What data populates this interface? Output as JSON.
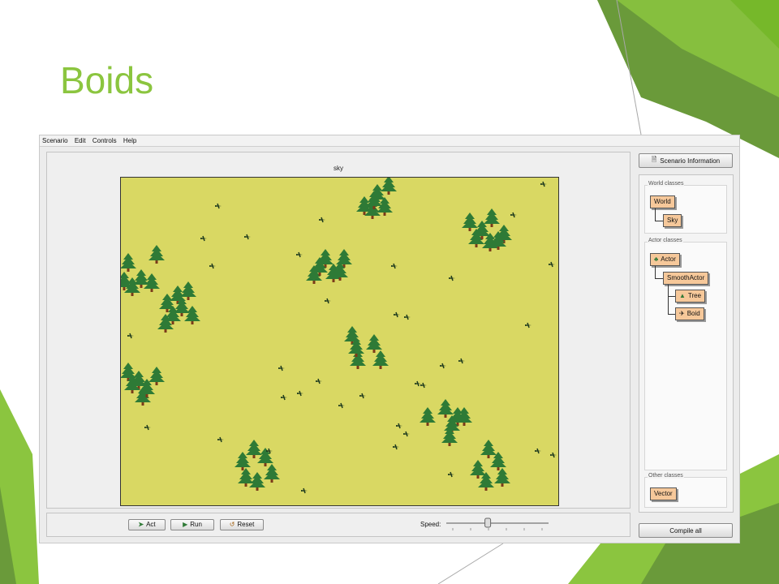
{
  "slide": {
    "title": "Boids"
  },
  "menu": {
    "items": [
      "Scenario",
      "Edit",
      "Controls",
      "Help"
    ]
  },
  "world": {
    "name": "sky"
  },
  "controls": {
    "act_label": "Act",
    "run_label": "Run",
    "reset_label": "Reset",
    "speed_label": "Speed:",
    "speed_value": 0.4
  },
  "sidebar": {
    "scenario_info_label": "Scenario Information",
    "world_classes_title": "World classes",
    "actor_classes_title": "Actor classes",
    "other_classes_title": "Other classes",
    "world_classes": [
      "World",
      "Sky"
    ],
    "actor_classes": [
      "Actor",
      "SmoothActor",
      "Tree",
      "Boid"
    ],
    "other_classes": [
      "Vector"
    ],
    "compile_label": "Compile all"
  },
  "colors": {
    "accent_green": "#8bc53f",
    "world_background": "#d9d863",
    "class_box": "#f6c89a"
  }
}
